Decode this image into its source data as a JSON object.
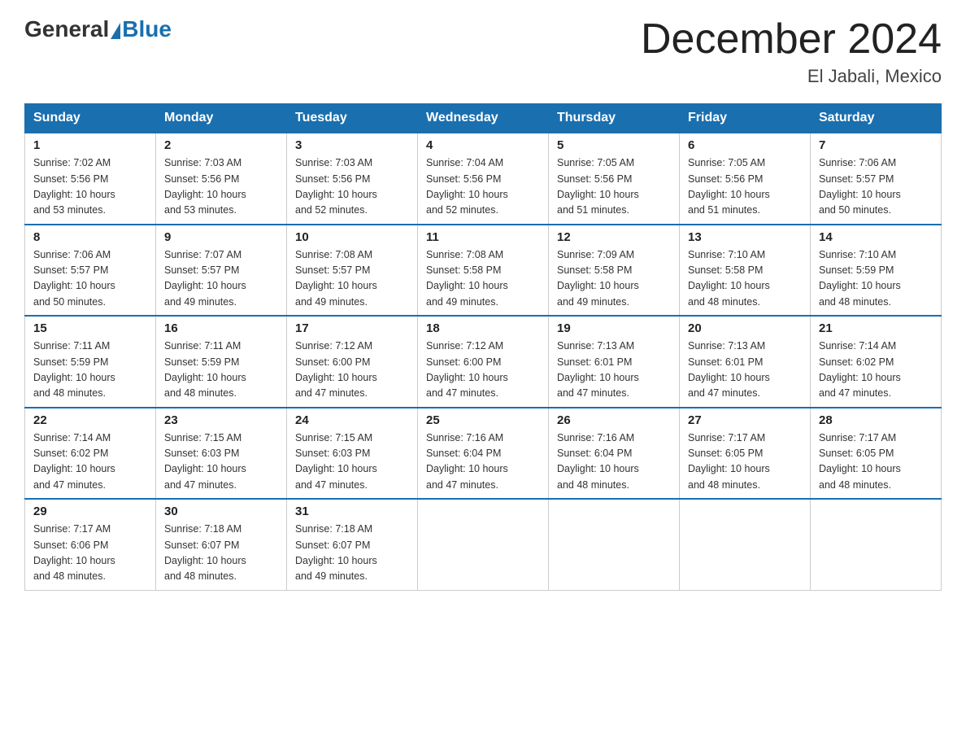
{
  "header": {
    "logo_general": "General",
    "logo_blue": "Blue",
    "title": "December 2024",
    "location": "El Jabali, Mexico"
  },
  "days_of_week": [
    "Sunday",
    "Monday",
    "Tuesday",
    "Wednesday",
    "Thursday",
    "Friday",
    "Saturday"
  ],
  "weeks": [
    [
      {
        "day": "1",
        "sunrise": "7:02 AM",
        "sunset": "5:56 PM",
        "daylight": "10 hours and 53 minutes."
      },
      {
        "day": "2",
        "sunrise": "7:03 AM",
        "sunset": "5:56 PM",
        "daylight": "10 hours and 53 minutes."
      },
      {
        "day": "3",
        "sunrise": "7:03 AM",
        "sunset": "5:56 PM",
        "daylight": "10 hours and 52 minutes."
      },
      {
        "day": "4",
        "sunrise": "7:04 AM",
        "sunset": "5:56 PM",
        "daylight": "10 hours and 52 minutes."
      },
      {
        "day": "5",
        "sunrise": "7:05 AM",
        "sunset": "5:56 PM",
        "daylight": "10 hours and 51 minutes."
      },
      {
        "day": "6",
        "sunrise": "7:05 AM",
        "sunset": "5:56 PM",
        "daylight": "10 hours and 51 minutes."
      },
      {
        "day": "7",
        "sunrise": "7:06 AM",
        "sunset": "5:57 PM",
        "daylight": "10 hours and 50 minutes."
      }
    ],
    [
      {
        "day": "8",
        "sunrise": "7:06 AM",
        "sunset": "5:57 PM",
        "daylight": "10 hours and 50 minutes."
      },
      {
        "day": "9",
        "sunrise": "7:07 AM",
        "sunset": "5:57 PM",
        "daylight": "10 hours and 49 minutes."
      },
      {
        "day": "10",
        "sunrise": "7:08 AM",
        "sunset": "5:57 PM",
        "daylight": "10 hours and 49 minutes."
      },
      {
        "day": "11",
        "sunrise": "7:08 AM",
        "sunset": "5:58 PM",
        "daylight": "10 hours and 49 minutes."
      },
      {
        "day": "12",
        "sunrise": "7:09 AM",
        "sunset": "5:58 PM",
        "daylight": "10 hours and 49 minutes."
      },
      {
        "day": "13",
        "sunrise": "7:10 AM",
        "sunset": "5:58 PM",
        "daylight": "10 hours and 48 minutes."
      },
      {
        "day": "14",
        "sunrise": "7:10 AM",
        "sunset": "5:59 PM",
        "daylight": "10 hours and 48 minutes."
      }
    ],
    [
      {
        "day": "15",
        "sunrise": "7:11 AM",
        "sunset": "5:59 PM",
        "daylight": "10 hours and 48 minutes."
      },
      {
        "day": "16",
        "sunrise": "7:11 AM",
        "sunset": "5:59 PM",
        "daylight": "10 hours and 48 minutes."
      },
      {
        "day": "17",
        "sunrise": "7:12 AM",
        "sunset": "6:00 PM",
        "daylight": "10 hours and 47 minutes."
      },
      {
        "day": "18",
        "sunrise": "7:12 AM",
        "sunset": "6:00 PM",
        "daylight": "10 hours and 47 minutes."
      },
      {
        "day": "19",
        "sunrise": "7:13 AM",
        "sunset": "6:01 PM",
        "daylight": "10 hours and 47 minutes."
      },
      {
        "day": "20",
        "sunrise": "7:13 AM",
        "sunset": "6:01 PM",
        "daylight": "10 hours and 47 minutes."
      },
      {
        "day": "21",
        "sunrise": "7:14 AM",
        "sunset": "6:02 PM",
        "daylight": "10 hours and 47 minutes."
      }
    ],
    [
      {
        "day": "22",
        "sunrise": "7:14 AM",
        "sunset": "6:02 PM",
        "daylight": "10 hours and 47 minutes."
      },
      {
        "day": "23",
        "sunrise": "7:15 AM",
        "sunset": "6:03 PM",
        "daylight": "10 hours and 47 minutes."
      },
      {
        "day": "24",
        "sunrise": "7:15 AM",
        "sunset": "6:03 PM",
        "daylight": "10 hours and 47 minutes."
      },
      {
        "day": "25",
        "sunrise": "7:16 AM",
        "sunset": "6:04 PM",
        "daylight": "10 hours and 47 minutes."
      },
      {
        "day": "26",
        "sunrise": "7:16 AM",
        "sunset": "6:04 PM",
        "daylight": "10 hours and 48 minutes."
      },
      {
        "day": "27",
        "sunrise": "7:17 AM",
        "sunset": "6:05 PM",
        "daylight": "10 hours and 48 minutes."
      },
      {
        "day": "28",
        "sunrise": "7:17 AM",
        "sunset": "6:05 PM",
        "daylight": "10 hours and 48 minutes."
      }
    ],
    [
      {
        "day": "29",
        "sunrise": "7:17 AM",
        "sunset": "6:06 PM",
        "daylight": "10 hours and 48 minutes."
      },
      {
        "day": "30",
        "sunrise": "7:18 AM",
        "sunset": "6:07 PM",
        "daylight": "10 hours and 48 minutes."
      },
      {
        "day": "31",
        "sunrise": "7:18 AM",
        "sunset": "6:07 PM",
        "daylight": "10 hours and 49 minutes."
      },
      null,
      null,
      null,
      null
    ]
  ],
  "labels": {
    "sunrise": "Sunrise:",
    "sunset": "Sunset:",
    "daylight": "Daylight:"
  }
}
